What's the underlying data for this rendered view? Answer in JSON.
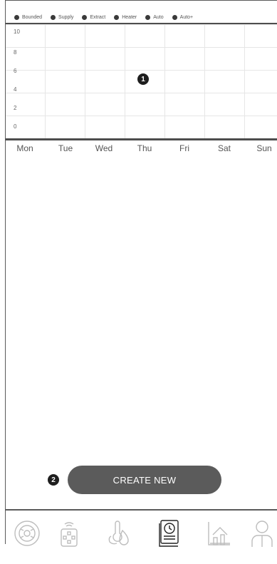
{
  "legend": [
    {
      "label": "Bounded"
    },
    {
      "label": "Supply"
    },
    {
      "label": "Extract"
    },
    {
      "label": "Heater"
    },
    {
      "label": "Auto"
    },
    {
      "label": "Auto+"
    }
  ],
  "chart": {
    "y_ticks": [
      "10",
      "8",
      "6",
      "4",
      "2",
      "0"
    ],
    "days": [
      "Mon",
      "Tue",
      "Wed",
      "Thu",
      "Fri",
      "Sat",
      "Sun"
    ]
  },
  "markers": {
    "chart": "1",
    "button": "2"
  },
  "create_button": {
    "label": "CREATE NEW"
  },
  "tabbar": {
    "tabs": [
      {
        "icon": "fan-icon",
        "active": false
      },
      {
        "icon": "remote-control-icon",
        "active": false
      },
      {
        "icon": "temperature-humidity-icon",
        "active": false
      },
      {
        "icon": "schedule-icon",
        "active": true
      },
      {
        "icon": "statistics-icon",
        "active": false
      },
      {
        "icon": "user-icon",
        "active": false
      }
    ]
  }
}
